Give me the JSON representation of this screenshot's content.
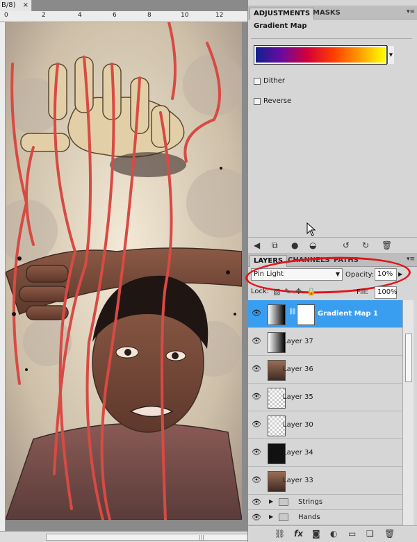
{
  "document": {
    "tab_label": "B/8)",
    "close_glyph": "×",
    "ruler_numbers": [
      "0",
      "2",
      "4",
      "6",
      "8",
      "10",
      "12"
    ]
  },
  "adjustments": {
    "tabs": [
      {
        "label": "ADJUSTMENTS",
        "active": true
      },
      {
        "label": "MASKS",
        "active": false
      }
    ],
    "title": "Gradient Map",
    "dither_label": "Dither",
    "reverse_label": "Reverse",
    "gradient_colors": [
      "#12208f",
      "#6b0aa0",
      "#d4003a",
      "#ff3d00",
      "#ff9a00",
      "#ffff00"
    ]
  },
  "layers": {
    "tabs": [
      {
        "label": "LAYERS",
        "active": true
      },
      {
        "label": "CHANNELS",
        "active": false
      },
      {
        "label": "PATHS",
        "active": false
      }
    ],
    "blend_mode": "Pin Light",
    "opacity_label": "Opacity:",
    "opacity_value": "10%",
    "lock_label": "Lock:",
    "fill_label": "Fill:",
    "fill_value": "100%",
    "items": [
      {
        "name": "Gradient Map 1",
        "thumb": "grad",
        "selected": true
      },
      {
        "name": "Layer 37",
        "thumb": "grad",
        "selected": false
      },
      {
        "name": "Layer 36",
        "thumb": "photo",
        "selected": false
      },
      {
        "name": "Layer 35",
        "thumb": "trans",
        "selected": false
      },
      {
        "name": "Layer 30",
        "thumb": "trans",
        "selected": false
      },
      {
        "name": "Layer 34",
        "thumb": "dark",
        "selected": false
      },
      {
        "name": "Layer 33",
        "thumb": "photo",
        "selected": false
      }
    ],
    "groups": [
      {
        "name": "Strings"
      },
      {
        "name": "Hands"
      }
    ]
  },
  "colors": {
    "selection_blue": "#3a9ef0",
    "annotation_red": "#e2141b"
  }
}
